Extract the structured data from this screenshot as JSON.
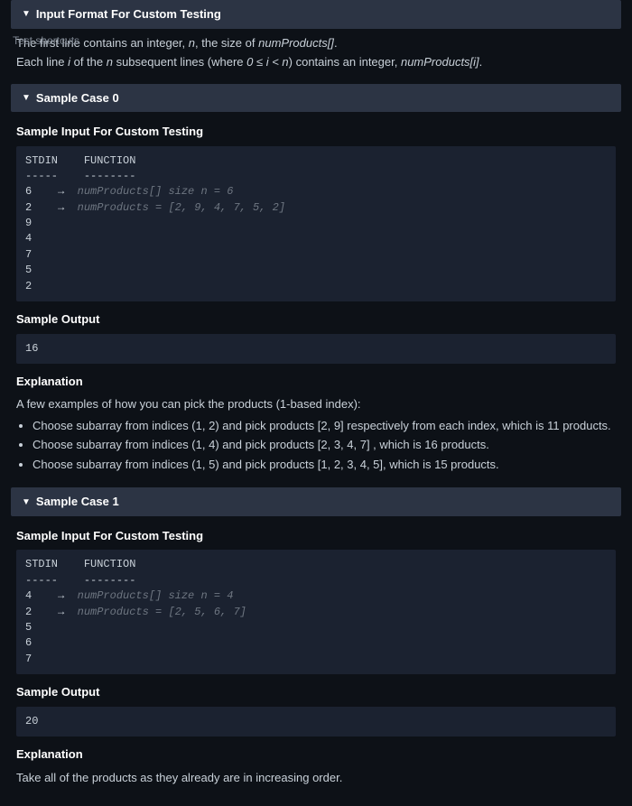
{
  "input_format": {
    "header": "Input Format For Custom Testing",
    "line1_prefix": "The first line contains an integer, ",
    "line1_var": "n",
    "line1_mid": ", the size of ",
    "line1_arr": "numProducts[]",
    "line1_suffix": ".",
    "line2_prefix": "Each line ",
    "line2_var_i": "i",
    "line2_mid1": " of the ",
    "line2_var_n": "n",
    "line2_mid2": " subsequent lines (where ",
    "line2_cond": "0 ≤ i < n",
    "line2_mid3": ") contains an integer, ",
    "line2_arr": "numProducts[i]",
    "line2_suffix": "."
  },
  "test_shortcuts": "Test shortcuts",
  "case0": {
    "header": "Sample Case 0",
    "sample_input_heading": "Sample Input For Custom Testing",
    "stdin_label": "STDIN",
    "func_label": "FUNCTION",
    "stdin_dashes": "-----",
    "func_dashes": "--------",
    "row1_stdin": "6",
    "row1_arrow": "→",
    "row1_func": "numProducts[] size n = 6",
    "row2_stdin": "2",
    "row2_arrow": "→",
    "row2_func": "numProducts = [2, 9, 4, 7, 5, 2]",
    "row3": "9",
    "row4": "4",
    "row5": "7",
    "row6": "5",
    "row7": "2",
    "sample_output_heading": "Sample Output",
    "sample_output": "16",
    "explanation_heading": "Explanation",
    "explanation_intro": "A few examples of how you can pick the products (1-based index):",
    "bullets": {
      "b1": "Choose subarray from indices (1, 2) and pick products [2, 9] respectively from each index, which is 11 products.",
      "b2": "Choose subarray from indices (1, 4) and pick products [2, 3, 4, 7] , which is 16 products.",
      "b3": "Choose subarray from indices (1, 5) and pick products [1, 2, 3, 4, 5], which is 15 products."
    }
  },
  "case1": {
    "header": "Sample Case 1",
    "sample_input_heading": "Sample Input For Custom Testing",
    "stdin_label": "STDIN",
    "func_label": "FUNCTION",
    "stdin_dashes": "-----",
    "func_dashes": "--------",
    "row1_stdin": "4",
    "row1_arrow": "→",
    "row1_func": "numProducts[] size n = 4",
    "row2_stdin": "2",
    "row2_arrow": "→",
    "row2_func": "numProducts = [2, 5, 6, 7]",
    "row3": "5",
    "row4": "6",
    "row5": "7",
    "sample_output_heading": "Sample Output",
    "sample_output": "20",
    "explanation_heading": "Explanation",
    "explanation_text": "Take all of the products as they already are in increasing order."
  }
}
